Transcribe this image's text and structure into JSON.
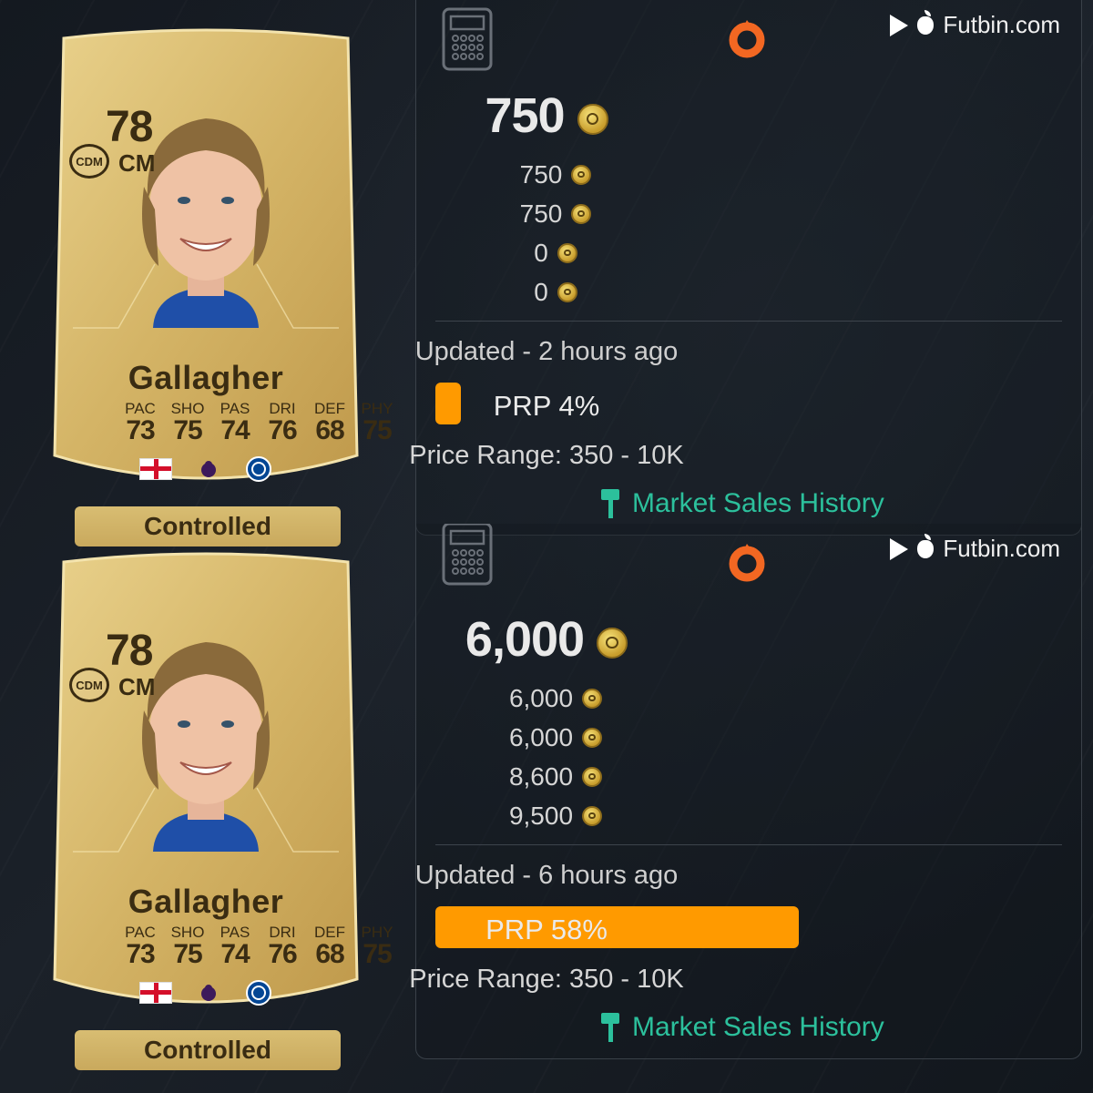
{
  "cards": [
    {
      "rating": "78",
      "alt_position": "CDM",
      "position": "CM",
      "name": "Gallagher",
      "stats": [
        {
          "label": "PAC",
          "value": "73"
        },
        {
          "label": "SHO",
          "value": "75"
        },
        {
          "label": "PAS",
          "value": "74"
        },
        {
          "label": "DRI",
          "value": "76"
        },
        {
          "label": "DEF",
          "value": "68"
        },
        {
          "label": "PHY",
          "value": "75"
        }
      ],
      "control_label": "Controlled",
      "nation_icon": "england-flag-icon",
      "league_icon": "premier-league-icon",
      "club_icon": "chelsea-badge-icon"
    },
    {
      "rating": "78",
      "alt_position": "CDM",
      "position": "CM",
      "name": "Gallagher",
      "stats": [
        {
          "label": "PAC",
          "value": "73"
        },
        {
          "label": "SHO",
          "value": "75"
        },
        {
          "label": "PAS",
          "value": "74"
        },
        {
          "label": "DRI",
          "value": "76"
        },
        {
          "label": "DEF",
          "value": "68"
        },
        {
          "label": "PHY",
          "value": "75"
        }
      ],
      "control_label": "Controlled",
      "nation_icon": "england-flag-icon",
      "league_icon": "premier-league-icon",
      "club_icon": "chelsea-badge-icon"
    }
  ],
  "prices": [
    {
      "brand": "Futbin.com",
      "platform_icon": "origin-icon",
      "main_price": "750",
      "list": [
        "750",
        "750",
        "0",
        "0"
      ],
      "updated": "Updated - 2 hours ago",
      "prp_label": "PRP 4%",
      "prp_percent": 4,
      "price_range": "Price Range: 350 - 10K",
      "market_link": "Market Sales History"
    },
    {
      "brand": "Futbin.com",
      "platform_icon": "origin-icon",
      "main_price": "6,000",
      "list": [
        "6,000",
        "6,000",
        "8,600",
        "9,500"
      ],
      "updated": "Updated - 6 hours ago",
      "prp_label": "PRP 58%",
      "prp_percent": 58,
      "price_range": "Price Range: 350 - 10K",
      "market_link": "Market Sales History"
    }
  ],
  "colors": {
    "accent_green": "#2cc09c",
    "prp_orange": "#ff9a00",
    "card_gold": "#d4b466"
  }
}
